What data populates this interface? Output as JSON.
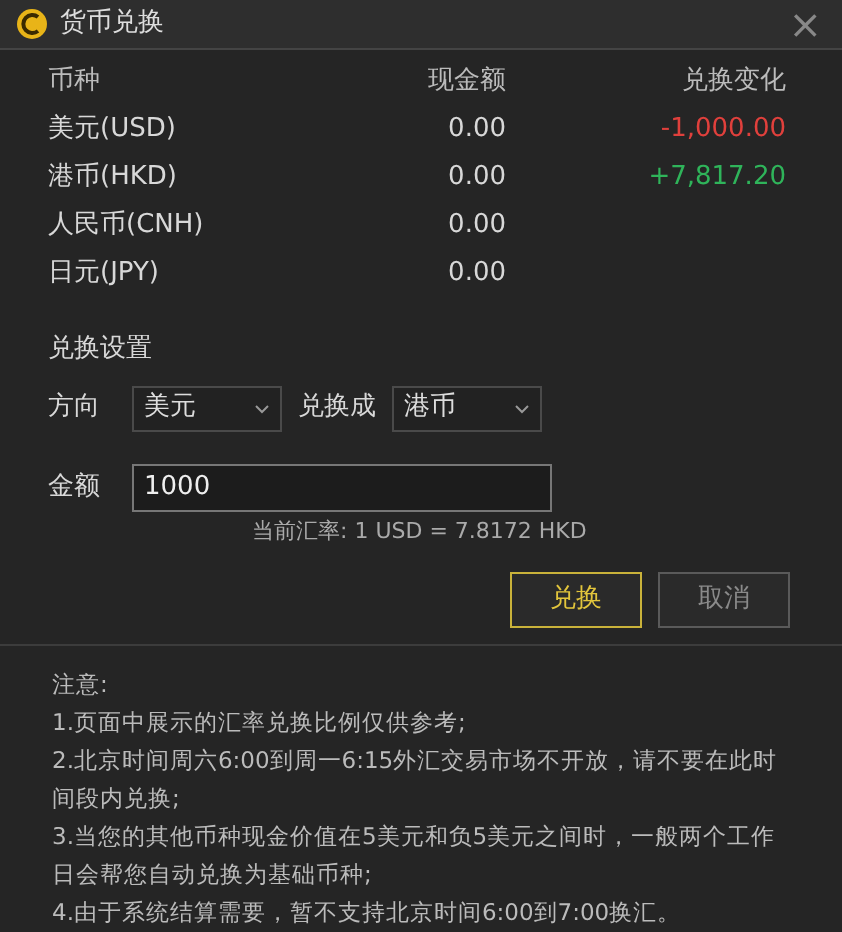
{
  "window": {
    "title": "货币兑换",
    "close": "×"
  },
  "table": {
    "columns": [
      "币种",
      "现金额",
      "兑换变化"
    ],
    "rows": [
      {
        "currency": "美元(USD)",
        "cash": "0.00",
        "change": "-1,000.00",
        "color": "#e0403c"
      },
      {
        "currency": "港币(HKD)",
        "cash": "0.00",
        "change": "+7,817.20",
        "color": "#2fb45a"
      },
      {
        "currency": "人民币(CNH)",
        "cash": "0.00"
      },
      {
        "currency": "日元(JPY)",
        "cash": "0.00"
      }
    ]
  },
  "settings": {
    "title": "兑换设置",
    "direction_label": "方向",
    "from": "美元",
    "to_label": "兑换成",
    "to": "港币",
    "amount_label": "金额",
    "amount": "1000",
    "rate": "当前汇率:  1 USD = 7.8172 HKD"
  },
  "buttons": [
    {
      "label": "兑换",
      "primary": true
    },
    {
      "label": "取消",
      "primary": false
    }
  ],
  "notes": [
    "注意:",
    "1.页面中展示的汇率兑换比例仅供参考;",
    "2.北京时间周六6:00到周一6:15外汇交易市场不开放，请不要在此时间段内兑换;",
    "3.当您的其他币种现金价值在5美元和负5美元之间时，一般两个工作日会帮您自动兑换为基础币种;",
    "4.由于系统结算需要，暂不支持北京时间6:00到7:00换汇。"
  ]
}
